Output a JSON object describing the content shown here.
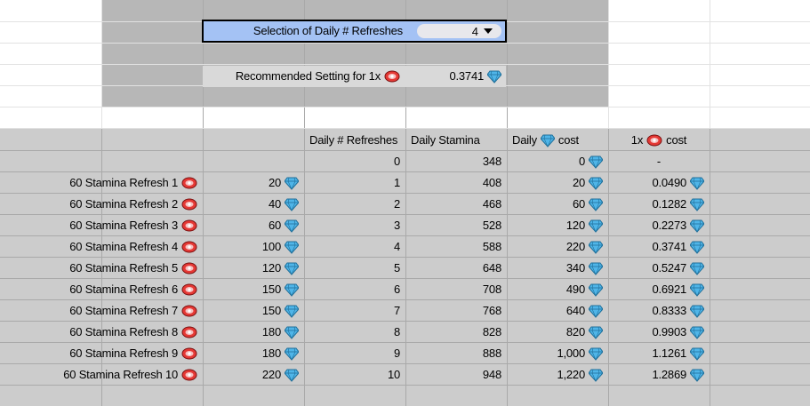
{
  "selection": {
    "label": "Selection of Daily # Refreshes",
    "value": "4"
  },
  "recommended": {
    "label": "Recommended Setting for 1x",
    "value": "0.3741"
  },
  "table": {
    "headers": {
      "refreshes": "Daily # Refreshes",
      "stamina": "Daily Stamina",
      "daily_cost": "Daily",
      "daily_cost_suffix": "cost",
      "onex": "1x",
      "onex_suffix": "cost"
    },
    "base_row": {
      "refreshes": "0",
      "stamina": "348",
      "daily_cost": "0",
      "onex": "-"
    },
    "rows": [
      {
        "label": "60 Stamina Refresh 1",
        "price": "20",
        "refreshes": "1",
        "stamina": "408",
        "daily_cost": "20",
        "onex": "0.0490"
      },
      {
        "label": "60 Stamina Refresh 2",
        "price": "40",
        "refreshes": "2",
        "stamina": "468",
        "daily_cost": "60",
        "onex": "0.1282"
      },
      {
        "label": "60 Stamina Refresh 3",
        "price": "60",
        "refreshes": "3",
        "stamina": "528",
        "daily_cost": "120",
        "onex": "0.2273"
      },
      {
        "label": "60 Stamina Refresh 4",
        "price": "100",
        "refreshes": "4",
        "stamina": "588",
        "daily_cost": "220",
        "onex": "0.3741"
      },
      {
        "label": "60 Stamina Refresh 5",
        "price": "120",
        "refreshes": "5",
        "stamina": "648",
        "daily_cost": "340",
        "onex": "0.5247"
      },
      {
        "label": "60 Stamina Refresh 6",
        "price": "150",
        "refreshes": "6",
        "stamina": "708",
        "daily_cost": "490",
        "onex": "0.6921"
      },
      {
        "label": "60 Stamina Refresh 7",
        "price": "150",
        "refreshes": "7",
        "stamina": "768",
        "daily_cost": "640",
        "onex": "0.8333"
      },
      {
        "label": "60 Stamina Refresh 8",
        "price": "180",
        "refreshes": "8",
        "stamina": "828",
        "daily_cost": "820",
        "onex": "0.9903"
      },
      {
        "label": "60 Stamina Refresh 9",
        "price": "180",
        "refreshes": "9",
        "stamina": "888",
        "daily_cost": "1,000",
        "onex": "1.1261"
      },
      {
        "label": "60 Stamina Refresh 10",
        "price": "220",
        "refreshes": "10",
        "stamina": "948",
        "daily_cost": "1,220",
        "onex": "1.2869"
      }
    ]
  },
  "icons": {
    "gem": "gem-icon",
    "meat": "meat-icon",
    "dropdown": "dropdown-arrow-icon"
  },
  "colors": {
    "selection_bg": "#a4c2f4",
    "gem": "#4fb5e8",
    "meat": "#e53935",
    "top_band": "#b7b7b7",
    "table_band": "#cccccc"
  }
}
